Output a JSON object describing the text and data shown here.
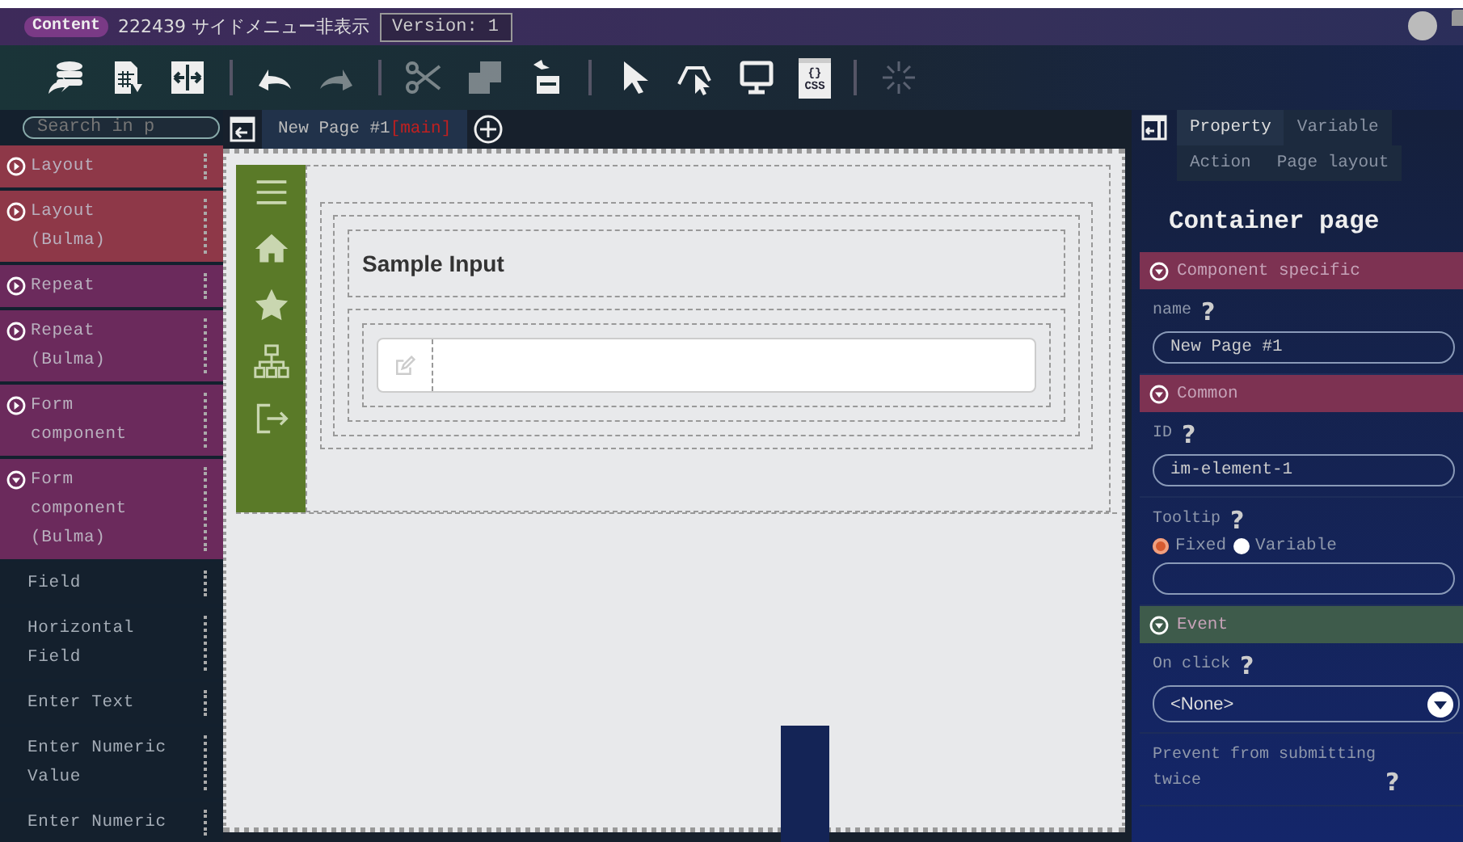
{
  "header": {
    "badge": "Content",
    "project": "222439 サイドメニュー非表示",
    "version": "Version: 1"
  },
  "toolbar": [
    {
      "kind": "db-import",
      "disabled": false
    },
    {
      "kind": "sheet-export",
      "disabled": false
    },
    {
      "kind": "resize",
      "disabled": false
    },
    {
      "kind": "separator"
    },
    {
      "kind": "undo",
      "disabled": false
    },
    {
      "kind": "redo",
      "disabled": true
    },
    {
      "kind": "separator"
    },
    {
      "kind": "cut",
      "disabled": true
    },
    {
      "kind": "copy",
      "disabled": true
    },
    {
      "kind": "paste",
      "disabled": false
    },
    {
      "kind": "separator"
    },
    {
      "kind": "pointer",
      "disabled": false
    },
    {
      "kind": "select-area",
      "disabled": false
    },
    {
      "kind": "monitor",
      "disabled": false
    },
    {
      "kind": "css",
      "disabled": false,
      "label": "{}",
      "sublabel": "CSS"
    },
    {
      "kind": "separator"
    },
    {
      "kind": "loading",
      "disabled": true
    }
  ],
  "sidebar": {
    "search": {
      "placeholder": "Search in p"
    },
    "items": [
      {
        "kind": "group",
        "label": "Layout",
        "color": "#8e3848",
        "expanded": false
      },
      {
        "kind": "group",
        "label": "Layout\n(Bulma)",
        "color": "#8e3848",
        "expanded": false
      },
      {
        "kind": "group",
        "label": "Repeat",
        "color": "#6b2a5c",
        "expanded": false
      },
      {
        "kind": "group",
        "label": "Repeat\n(Bulma)",
        "color": "#6b2a5c",
        "expanded": false
      },
      {
        "kind": "group",
        "label": "Form\ncomponent",
        "color": "#6b2a5c",
        "expanded": false
      },
      {
        "kind": "group",
        "label": "Form\ncomponent\n(Bulma)",
        "color": "#6b2a5c",
        "expanded": true
      },
      {
        "kind": "component",
        "label": "Field"
      },
      {
        "kind": "component",
        "label": "Horizontal\nField"
      },
      {
        "kind": "component",
        "label": "Enter Text"
      },
      {
        "kind": "component",
        "label": "Enter Numeric\nValue"
      },
      {
        "kind": "component",
        "label": "Enter Numeric"
      }
    ]
  },
  "canvas": {
    "tabs": [
      {
        "label": "New Page #1",
        "tag": "[main]",
        "selected": true
      }
    ],
    "side_nav": [
      {
        "kind": "menu"
      },
      {
        "kind": "home"
      },
      {
        "kind": "star"
      },
      {
        "kind": "sitemap"
      },
      {
        "kind": "logout"
      }
    ],
    "heading": "Sample Input"
  },
  "panel": {
    "tabs": [
      {
        "label": "Property",
        "selected": true
      },
      {
        "label": "Variable",
        "selected": false
      },
      {
        "label": "Action",
        "selected": false
      },
      {
        "label": "Page layout",
        "selected": false
      }
    ],
    "title": "Container page",
    "sections": [
      {
        "title": "Component specific",
        "color": "#7d3252",
        "fields": [
          {
            "kind": "text",
            "label": "name",
            "help": "?",
            "value": "New Page #1"
          }
        ]
      },
      {
        "title": "Common",
        "color": "#7d3252",
        "fields": [
          {
            "kind": "text",
            "label": "ID",
            "help": "?",
            "value": "im-element-1"
          },
          {
            "kind": "radio",
            "label": "Tooltip",
            "help": "?",
            "options": [
              {
                "label": "Fixed",
                "selected": true
              },
              {
                "label": "Variable",
                "selected": false
              }
            ]
          }
        ]
      },
      {
        "title": "Event",
        "color": "#3e5b4b",
        "fields": [
          {
            "kind": "select",
            "label": "On click",
            "help": "?",
            "value": "<None>"
          },
          {
            "kind": "note",
            "label": "Prevent from submitting\ntwice",
            "help": "?"
          }
        ]
      }
    ]
  }
}
